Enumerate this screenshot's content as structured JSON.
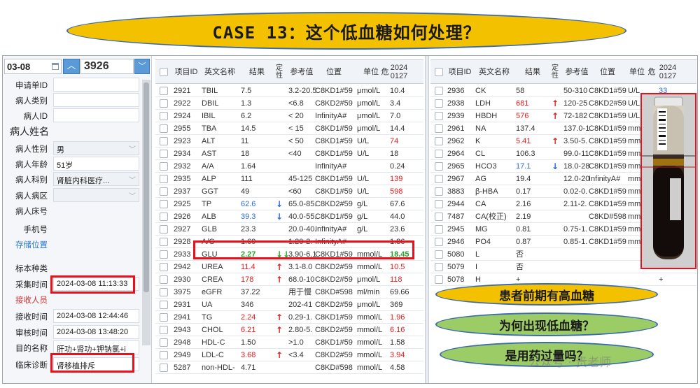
{
  "title": "CASE 13：这个低血糖如何处理？",
  "left_panel": {
    "date": "03-08",
    "sample_no": "3926",
    "rows": [
      {
        "label": "申请单ID",
        "value": ""
      },
      {
        "label": "病人类别",
        "value": ""
      },
      {
        "label": "病人ID",
        "value": ""
      },
      {
        "label": "病人姓名",
        "value": ""
      },
      {
        "label": "病人性别",
        "value": "男"
      },
      {
        "label": "病人年龄",
        "value": "51岁"
      },
      {
        "label": "病人科别",
        "value": "肾脏内科医疗..."
      },
      {
        "label": "病人病区",
        "value": ""
      },
      {
        "label": "病人床号",
        "value": ""
      },
      {
        "label": "手机号",
        "value": ""
      },
      {
        "label": "存储位置",
        "value": ""
      },
      {
        "label": "标本种类",
        "value": ""
      },
      {
        "label": "采集时间",
        "value": "2024-03-08 11:13:33"
      },
      {
        "label": "接收人员",
        "value": ""
      },
      {
        "label": "接收时间",
        "value": "2024-03-08 12:44:46"
      },
      {
        "label": "审核时间",
        "value": "2024-03-08 13:48:20"
      },
      {
        "label": "目的名称",
        "value": "肝功+肾功+钾钠氯+i"
      },
      {
        "label": "临床诊断",
        "value": "肾移植排斥"
      }
    ]
  },
  "table_headers": {
    "id": "项目ID",
    "name": "英文名称",
    "result": "结果",
    "flag": "定性",
    "ref": "参考值",
    "pos": "位置",
    "unit": "单位",
    "crit": "危",
    "date": "20240127"
  },
  "left_table": [
    {
      "id": "2921",
      "name": "TBIL",
      "result": "7.5",
      "color": "",
      "arrow": "",
      "ref": "3.2-20.5",
      "pos": "C8KD1#59",
      "unit": "μmol/L",
      "prev": "10.4",
      "prev_color": ""
    },
    {
      "id": "2922",
      "name": "DBIL",
      "result": "1.3",
      "color": "",
      "arrow": "",
      "ref": "<6.8",
      "pos": "C8KD2#59",
      "unit": "μmol/L",
      "prev": "3.4",
      "prev_color": ""
    },
    {
      "id": "2924",
      "name": "IBIL",
      "result": "6.2",
      "color": "",
      "arrow": "",
      "ref": "< 20",
      "pos": "InfinityA#",
      "unit": "μmol/L",
      "prev": "7.0",
      "prev_color": ""
    },
    {
      "id": "2955",
      "name": "TBA",
      "result": "14.5",
      "color": "",
      "arrow": "",
      "ref": "< 15",
      "pos": "C8KD1#59",
      "unit": "μmol/L",
      "prev": "14.4",
      "prev_color": ""
    },
    {
      "id": "2923",
      "name": "ALT",
      "result": "11",
      "color": "",
      "arrow": "",
      "ref": "< 50",
      "pos": "C8KD1#59",
      "unit": "U/L",
      "prev": "74",
      "prev_color": "red"
    },
    {
      "id": "2934",
      "name": "AST",
      "result": "18",
      "color": "",
      "arrow": "",
      "ref": "<40",
      "pos": "C8KD1#59",
      "unit": "U/L",
      "prev": "18",
      "prev_color": ""
    },
    {
      "id": "2932",
      "name": "A/A",
      "result": "1.64",
      "color": "",
      "arrow": "",
      "ref": "",
      "pos": "InfinityA#",
      "unit": "",
      "prev": "0.24",
      "prev_color": ""
    },
    {
      "id": "2935",
      "name": "ALP",
      "result": "111",
      "color": "",
      "arrow": "",
      "ref": "45-125",
      "pos": "C8KD1#59",
      "unit": "U/L",
      "prev": "139",
      "prev_color": "red"
    },
    {
      "id": "2937",
      "name": "GGT",
      "result": "49",
      "color": "",
      "arrow": "",
      "ref": "<60",
      "pos": "C8KD1#59",
      "unit": "U/L",
      "prev": "598",
      "prev_color": "red"
    },
    {
      "id": "2925",
      "name": "TP",
      "result": "62.6",
      "color": "blue",
      "arrow": "down",
      "ref": "65.0-85.",
      "pos": "C8KD2#59",
      "unit": "g/L",
      "prev": "67.6",
      "prev_color": ""
    },
    {
      "id": "2926",
      "name": "ALB",
      "result": "39.3",
      "color": "blue",
      "arrow": "down",
      "ref": "40.0-55.",
      "pos": "C8KD1#59",
      "unit": "g/L",
      "prev": "44.0",
      "prev_color": ""
    },
    {
      "id": "2927",
      "name": "GLB",
      "result": "23.3",
      "color": "",
      "arrow": "",
      "ref": "20.0-40.",
      "pos": "InfinityA#",
      "unit": "g/L",
      "prev": "23.6",
      "prev_color": ""
    },
    {
      "id": "2928",
      "name": "A/G",
      "result": "1.69",
      "color": "",
      "arrow": "",
      "ref": "1.20-2.",
      "pos": "InfinityA#",
      "unit": "",
      "prev": "1.86",
      "prev_color": ""
    },
    {
      "id": "2933",
      "name": "GLU",
      "result": "2.27",
      "color": "green",
      "arrow": "down2",
      "ref": "3.90-6.1",
      "pos": "C8KD1#59",
      "unit": "mmol/L",
      "prev": "18.45",
      "prev_color": "green"
    },
    {
      "id": "2942",
      "name": "UREA",
      "result": "11.4",
      "color": "red",
      "arrow": "up",
      "ref": "3.1-8.0",
      "pos": "C8KD2#59",
      "unit": "mmol/L",
      "prev": "10.5",
      "prev_color": "red"
    },
    {
      "id": "2930",
      "name": "CREA",
      "result": "178",
      "color": "red",
      "arrow": "up",
      "ref": "68.0-10",
      "pos": "C8KD2#59",
      "unit": "μmol/L",
      "prev": "118",
      "prev_color": "red"
    },
    {
      "id": "3975",
      "name": "eGFR",
      "result": "37.22",
      "color": "",
      "arrow": "",
      "ref": "用于慢",
      "pos": "C8KD#598",
      "unit": "ml/min",
      "prev": "69.66",
      "prev_color": ""
    },
    {
      "id": "2931",
      "name": "UA",
      "result": "346",
      "color": "",
      "arrow": "",
      "ref": "202-41",
      "pos": "C8KD2#59",
      "unit": "μmol/L",
      "prev": "369",
      "prev_color": ""
    },
    {
      "id": "2941",
      "name": "TG",
      "result": "2.24",
      "color": "red",
      "arrow": "up",
      "ref": "0.29-1.",
      "pos": "C8KD1#59",
      "unit": "mmol/L",
      "prev": "1.96",
      "prev_color": "red"
    },
    {
      "id": "2943",
      "name": "CHOL",
      "result": "6.21",
      "color": "red",
      "arrow": "up",
      "ref": "2.80-5.",
      "pos": "C8KD2#59",
      "unit": "mmol/L",
      "prev": "6.16",
      "prev_color": "red"
    },
    {
      "id": "2948",
      "name": "HDL-C",
      "result": "1.50",
      "color": "",
      "arrow": "",
      "ref": ">1.0",
      "pos": "C8KD1#59",
      "unit": "mmol/L",
      "prev": "1.58",
      "prev_color": ""
    },
    {
      "id": "2949",
      "name": "LDL-C",
      "result": "3.68",
      "color": "red",
      "arrow": "up",
      "ref": "<3.4",
      "pos": "C8KD2#59",
      "unit": "mmol/L",
      "prev": "3.94",
      "prev_color": "red"
    },
    {
      "id": "5287",
      "name": "non-HDL-",
      "result": "4.71",
      "color": "",
      "arrow": "",
      "ref": "",
      "pos": "C8KD#598",
      "unit": "mmol/L",
      "prev": "4.58",
      "prev_color": ""
    }
  ],
  "right_table": [
    {
      "id": "2936",
      "name": "CK",
      "result": "58",
      "color": "",
      "arrow": "",
      "ref": "50-310",
      "pos": "C8KD1#59",
      "unit": "U/L",
      "prev": "33",
      "prev_color": "blue"
    },
    {
      "id": "2938",
      "name": "LDH",
      "result": "681",
      "color": "red",
      "arrow": "up",
      "ref": "120-25",
      "pos": "C8KD2#59",
      "unit": "U/L",
      "prev": "",
      "prev_color": ""
    },
    {
      "id": "2939",
      "name": "HBDH",
      "result": "576",
      "color": "red",
      "arrow": "up",
      "ref": "72-182",
      "pos": "C8KD1#59",
      "unit": "U/L",
      "prev": "",
      "prev_color": ""
    },
    {
      "id": "2961",
      "name": "NA",
      "result": "137.4",
      "color": "",
      "arrow": "",
      "ref": "137.0-1",
      "pos": "C8KD1#59",
      "unit": "mmo",
      "prev": "",
      "prev_color": ""
    },
    {
      "id": "2962",
      "name": "K",
      "result": "5.41",
      "color": "red",
      "arrow": "up",
      "ref": "3.50-5.",
      "pos": "C8KD1#59",
      "unit": "mmo",
      "prev": "",
      "prev_color": ""
    },
    {
      "id": "2964",
      "name": "CL",
      "result": "106.3",
      "color": "",
      "arrow": "",
      "ref": "99.0-11",
      "pos": "C8KD1#59",
      "unit": "mmo",
      "prev": "",
      "prev_color": ""
    },
    {
      "id": "2965",
      "name": "HCO3",
      "result": "17.1",
      "color": "blue",
      "arrow": "down",
      "ref": "18.0-28",
      "pos": "C8KD1#59",
      "unit": "mmo",
      "prev": "",
      "prev_color": ""
    },
    {
      "id": "2967",
      "name": "AG",
      "result": "19.4",
      "color": "",
      "arrow": "",
      "ref": "12.0-20",
      "pos": "InfinityA#",
      "unit": "mmo",
      "prev": "",
      "prev_color": ""
    },
    {
      "id": "3883",
      "name": "β-HBA",
      "result": "0.17",
      "color": "",
      "arrow": "",
      "ref": "0.02-0.",
      "pos": "C8KD1#59",
      "unit": "mmo",
      "prev": "",
      "prev_color": ""
    },
    {
      "id": "2944",
      "name": "CA",
      "result": "2.16",
      "color": "",
      "arrow": "",
      "ref": "2.11-2.",
      "pos": "C8KD1#59",
      "unit": "mmo",
      "prev": "",
      "prev_color": ""
    },
    {
      "id": "7487",
      "name": "CA(校正)",
      "result": "2.19",
      "color": "",
      "arrow": "",
      "ref": "",
      "pos": "C8KD#598",
      "unit": "mmo",
      "prev": "",
      "prev_color": ""
    },
    {
      "id": "2945",
      "name": "MG",
      "result": "0.81",
      "color": "",
      "arrow": "",
      "ref": "0.75-1.",
      "pos": "C8KD1#59",
      "unit": "mmo",
      "prev": "",
      "prev_color": ""
    },
    {
      "id": "2946",
      "name": "PO4",
      "result": "0.87",
      "color": "",
      "arrow": "",
      "ref": "0.85-1.",
      "pos": "C8KD1#59",
      "unit": "mmo",
      "prev": "",
      "prev_color": ""
    },
    {
      "id": "5080",
      "name": "L",
      "result": "否",
      "color": "",
      "arrow": "",
      "ref": "",
      "pos": "",
      "unit": "",
      "prev": "",
      "prev_color": ""
    },
    {
      "id": "5079",
      "name": "I",
      "result": "否",
      "color": "",
      "arrow": "",
      "ref": "",
      "pos": "",
      "unit": "",
      "prev": "",
      "prev_color": ""
    },
    {
      "id": "5078",
      "name": "H",
      "result": "+",
      "color": "",
      "arrow": "",
      "ref": "",
      "pos": "",
      "unit": "",
      "prev": "+",
      "prev_color": ""
    }
  ],
  "notes": {
    "note1": "患者前期有高血糖",
    "note2": "为何出现低血糖？",
    "note3": "是用药过量吗？"
  },
  "watermark": "公众号 · 贵老师",
  "colors": {
    "red": "#e02020",
    "blue": "#2a6ad6",
    "green": "#2aa02a",
    "highlight": "#e8101a",
    "title_bg": "#f4c100",
    "note_green": "#9ccc65"
  }
}
